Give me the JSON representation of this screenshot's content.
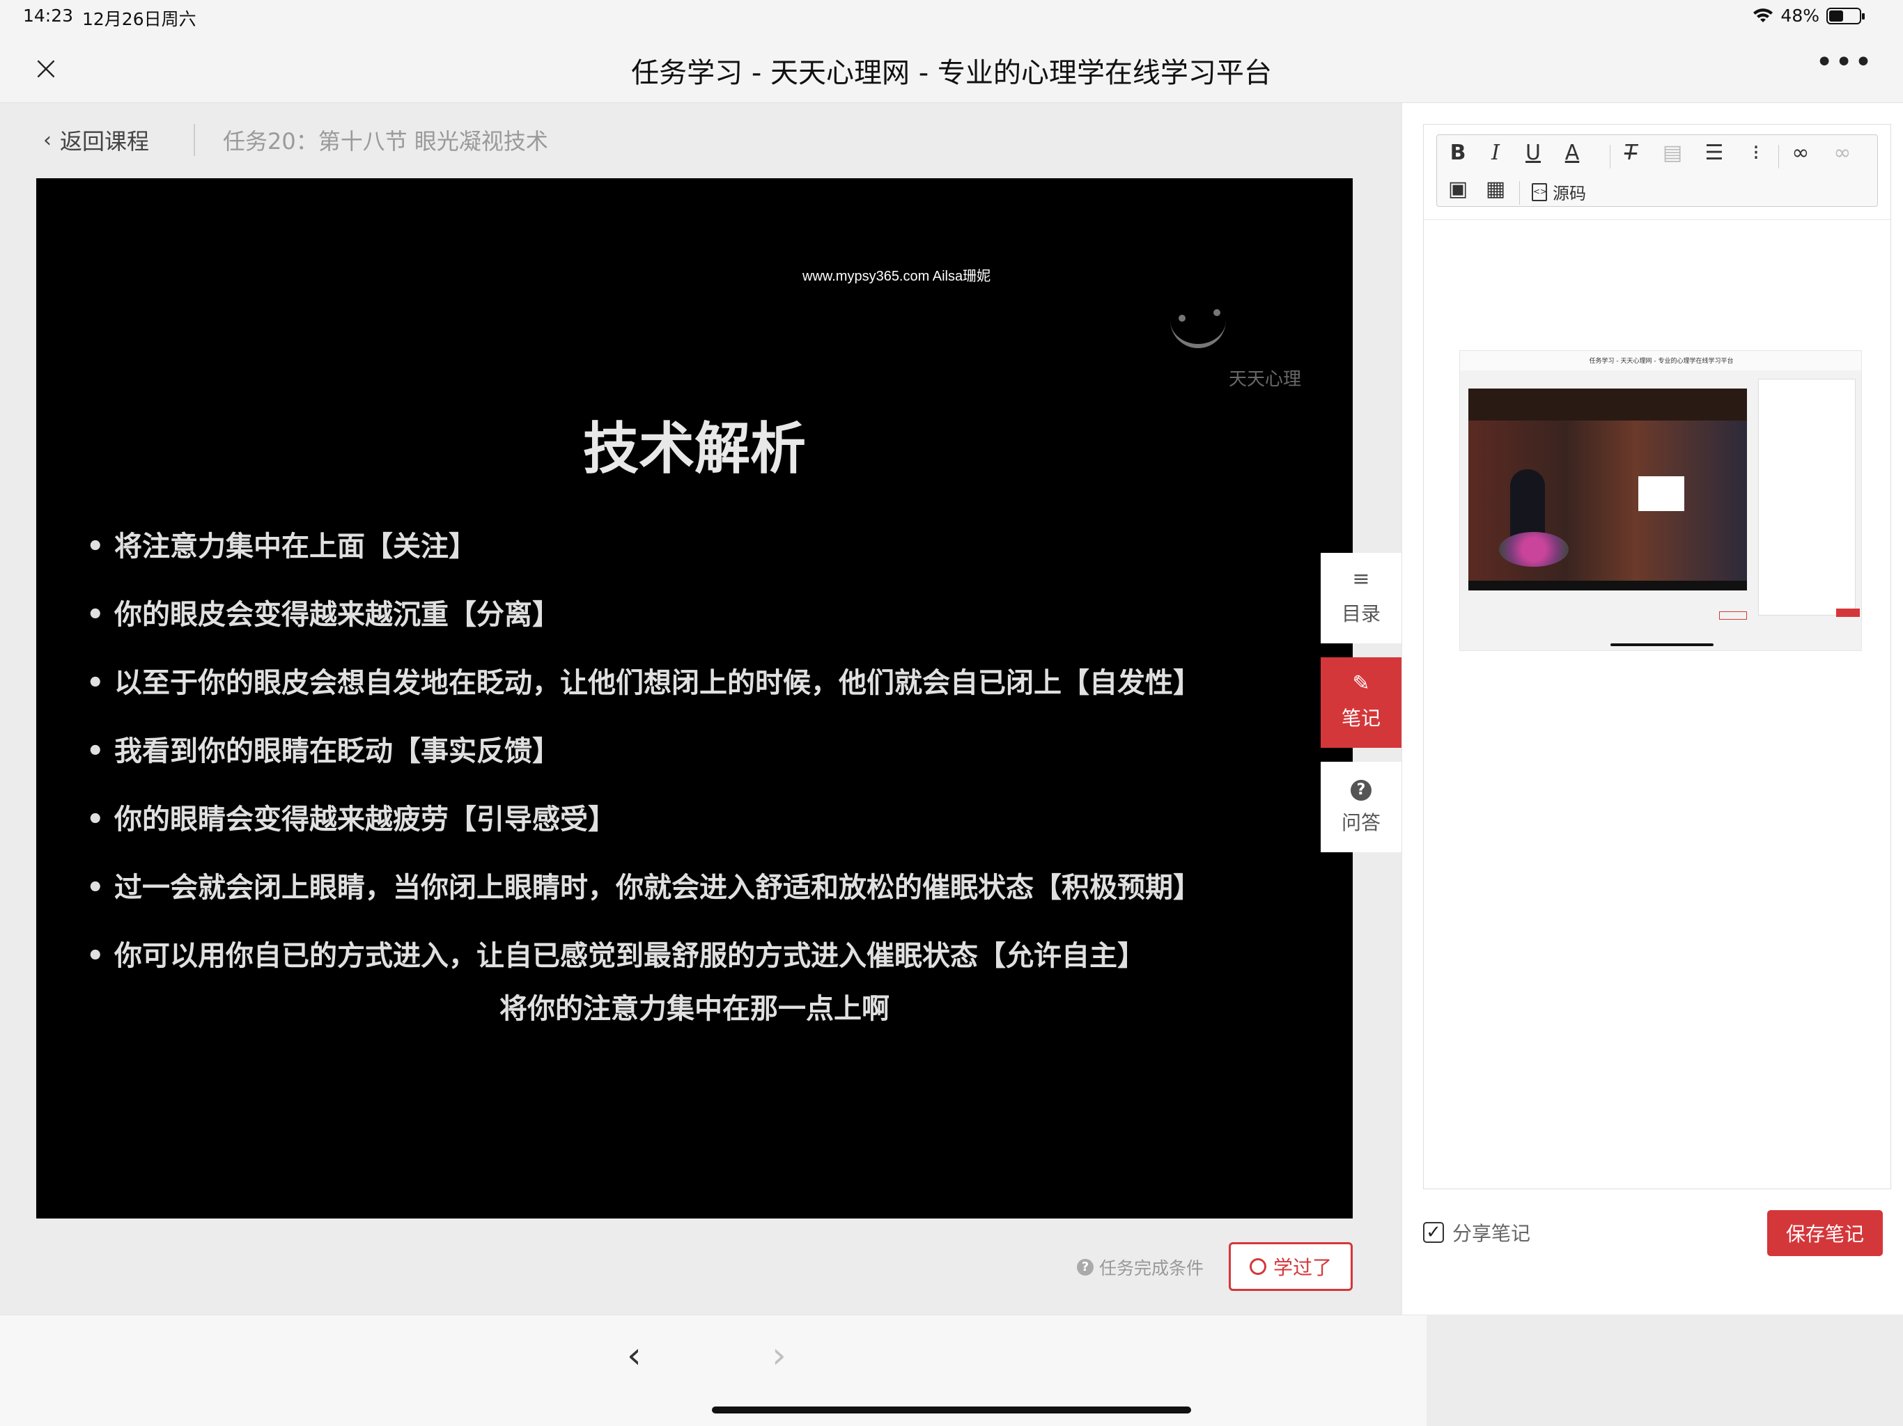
{
  "status_bar": {
    "time": "14:23",
    "date": "12月26日周六",
    "battery_text": "48%",
    "battery_level": 0.48
  },
  "title_bar": {
    "title": "任务学习 - 天天心理网 - 专业的心理学在线学习平台",
    "close_glyph": "×",
    "more_glyph": "•••"
  },
  "breadcrumb": {
    "back_label": "返回课程",
    "task_label": "任务20：第十八节 眼光凝视技术"
  },
  "video": {
    "watermark": "www.mypsy365.com Ailsa珊妮",
    "logo_text": "天天心理",
    "slide_title": "技术解析",
    "bullets": [
      "将注意力集中在上面【关注】",
      "你的眼皮会变得越来越沉重【分离】",
      "以至于你的眼皮会想自发地在眨动，让他们想闭上的时候，他们就会自已闭上【自发性】",
      "我看到你的眼睛在眨动【事实反馈】",
      "你的眼睛会变得越来越疲劳【引导感受】",
      "过一会就会闭上眼睛，当你闭上眼睛时，你就会进入舒适和放松的催眠状态【积极预期】",
      "你可以用你自已的方式进入，让自已感觉到最舒服的方式进入催眠状态【允许自主】"
    ],
    "subtitle": "将你的注意力集中在那一点上啊"
  },
  "side_tabs": [
    {
      "label": "目录",
      "icon": "list-icon",
      "glyph": "≡"
    },
    {
      "label": "笔记",
      "icon": "pencil-icon",
      "glyph": "✎",
      "active": true
    },
    {
      "label": "问答",
      "icon": "question-icon",
      "glyph": "?"
    }
  ],
  "task_footer": {
    "condition_label": "任务完成条件",
    "learned_label": "学过了"
  },
  "bottom_nav": {
    "prev": "‹",
    "next": "›"
  },
  "notes": {
    "toolbar": {
      "bold": "B",
      "italic": "I",
      "underline": "U",
      "font_color": "A",
      "clear_format": "T",
      "source_label": "源码"
    },
    "share_label": "分享笔记",
    "share_checked": true,
    "save_label": "保存笔记"
  },
  "thumbnail": {
    "title": "任务学习 - 天天心理网 - 专业的心理学在线学习平台"
  },
  "colors": {
    "accent": "#d4373a",
    "video_bg": "#000000",
    "panel_bg": "#ffffff",
    "page_bg": "#ececec"
  }
}
